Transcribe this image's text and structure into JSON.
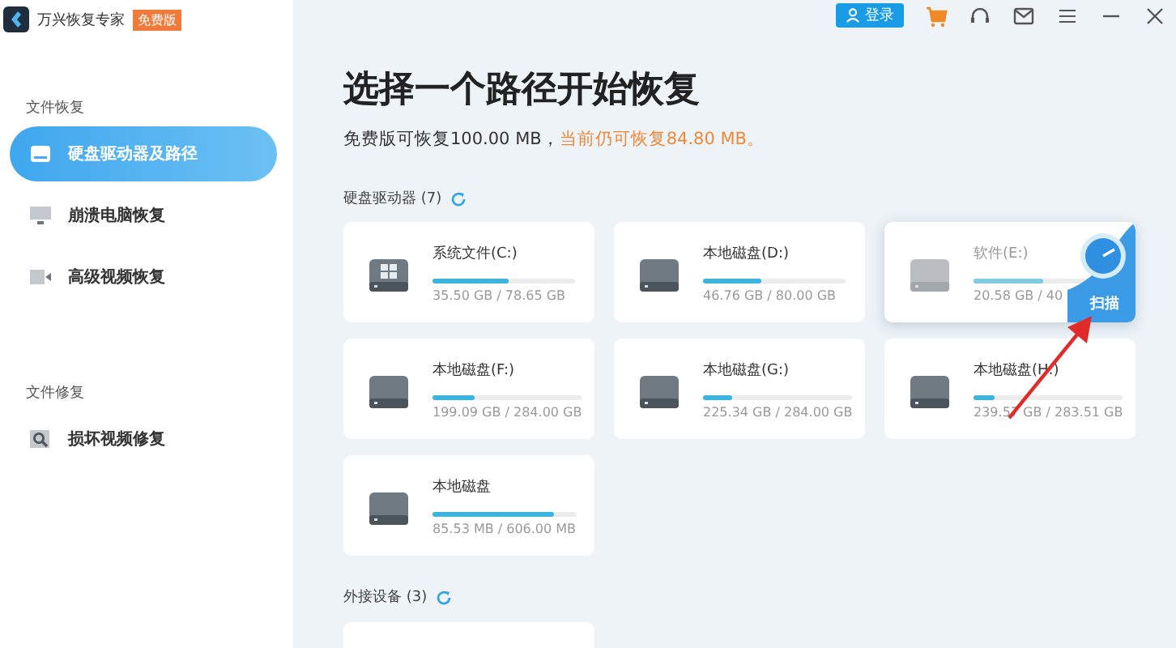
{
  "app": {
    "title": "万兴恢复专家",
    "badge": "免费版"
  },
  "top_bar": {
    "login": "登录"
  },
  "sidebar": {
    "sections": [
      {
        "heading": "文件恢复",
        "items": [
          {
            "label": "硬盘驱动器及路径",
            "kind": "drive",
            "selected": true
          },
          {
            "label": "崩溃电脑恢复",
            "kind": "pc",
            "selected": false
          },
          {
            "label": "高级视频恢复",
            "kind": "video",
            "selected": false
          }
        ]
      },
      {
        "heading": "文件修复",
        "items": [
          {
            "label": "损坏视频修复",
            "kind": "repair",
            "selected": false
          }
        ]
      }
    ]
  },
  "main": {
    "title": "选择一个路径开始恢复",
    "notice": "免费版可恢复100.00 MB，",
    "notice_highlight": "当前仍可恢复84.80 MB。",
    "drive_section": {
      "label": "硬盘驱动器 (7)",
      "drives": [
        {
          "name": "系统文件(C:)",
          "usage": "35.50 GB / 78.65 GB",
          "level": 0.53,
          "kind": "windows",
          "hovered": false
        },
        {
          "name": "本地磁盘(D:)",
          "usage": "46.76 GB / 80.00 GB",
          "level": 0.41,
          "kind": "plain",
          "hovered": false
        },
        {
          "name": "软件(E:)",
          "usage": "20.58 GB / 40",
          "level": 0.49,
          "kind": "plain",
          "hovered": true,
          "scan_label": "扫描"
        },
        {
          "name": "本地磁盘(F:)",
          "usage": "199.09 GB / 284.00 GB",
          "level": 0.28,
          "kind": "plain",
          "hovered": false
        },
        {
          "name": "本地磁盘(G:)",
          "usage": "225.34 GB / 284.00 GB",
          "level": 0.2,
          "kind": "plain",
          "hovered": false
        },
        {
          "name": "本地磁盘(H:)",
          "usage": "239.57 GB / 283.51 GB",
          "level": 0.14,
          "kind": "plain",
          "hovered": false
        },
        {
          "name": "本地磁盘",
          "usage": "85.53 MB / 606.00 MB",
          "level": 0.85,
          "kind": "plain",
          "hovered": false
        }
      ]
    },
    "external_section": {
      "label": "外接设备 (3)"
    }
  }
}
